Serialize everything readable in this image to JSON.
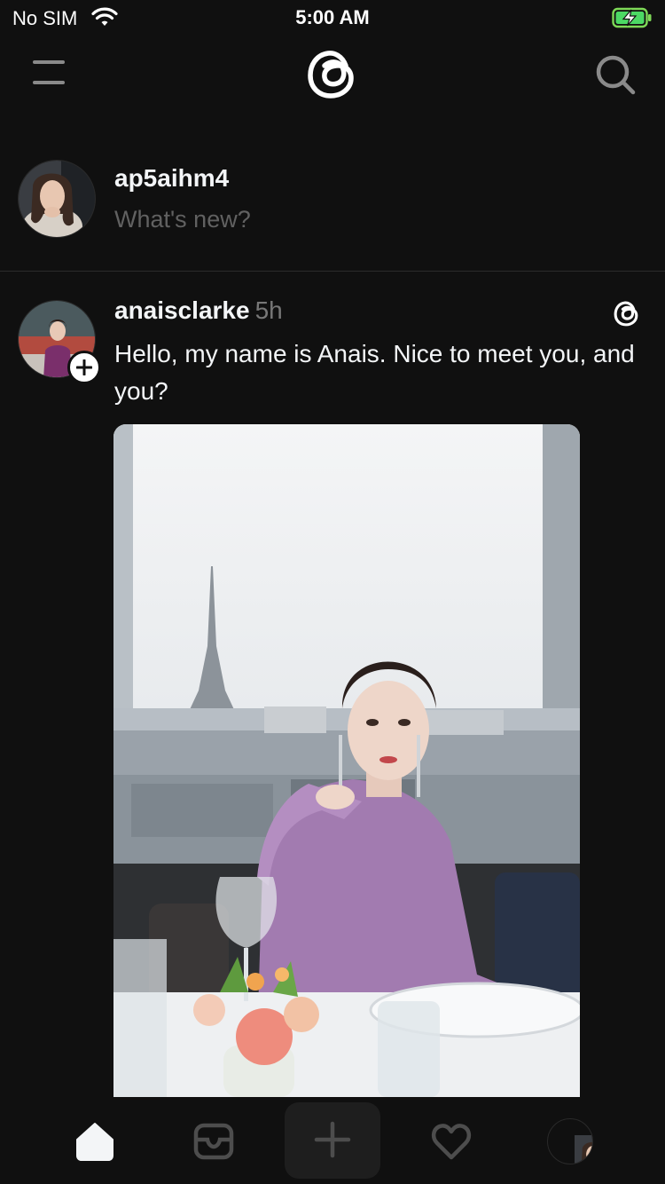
{
  "status_bar": {
    "carrier": "No SIM",
    "time": "5:00 AM"
  },
  "header": {
    "logo_icon": "threads-logo-icon",
    "menu_icon": "menu-icon",
    "search_icon": "search-icon"
  },
  "composer": {
    "username": "ap5aihm4",
    "placeholder": "What's new?"
  },
  "post": {
    "username": "anaisclarke",
    "time": "5h",
    "text": "Hello, my name is Anais. Nice to meet you, and you?"
  },
  "tab_bar": {
    "items": [
      "home-icon",
      "messages-icon",
      "create-icon",
      "heart-icon",
      "profile-avatar"
    ]
  },
  "colors": {
    "background": "#101010",
    "text_primary": "#f3f5f7",
    "text_secondary": "#777777",
    "placeholder": "#616161"
  }
}
